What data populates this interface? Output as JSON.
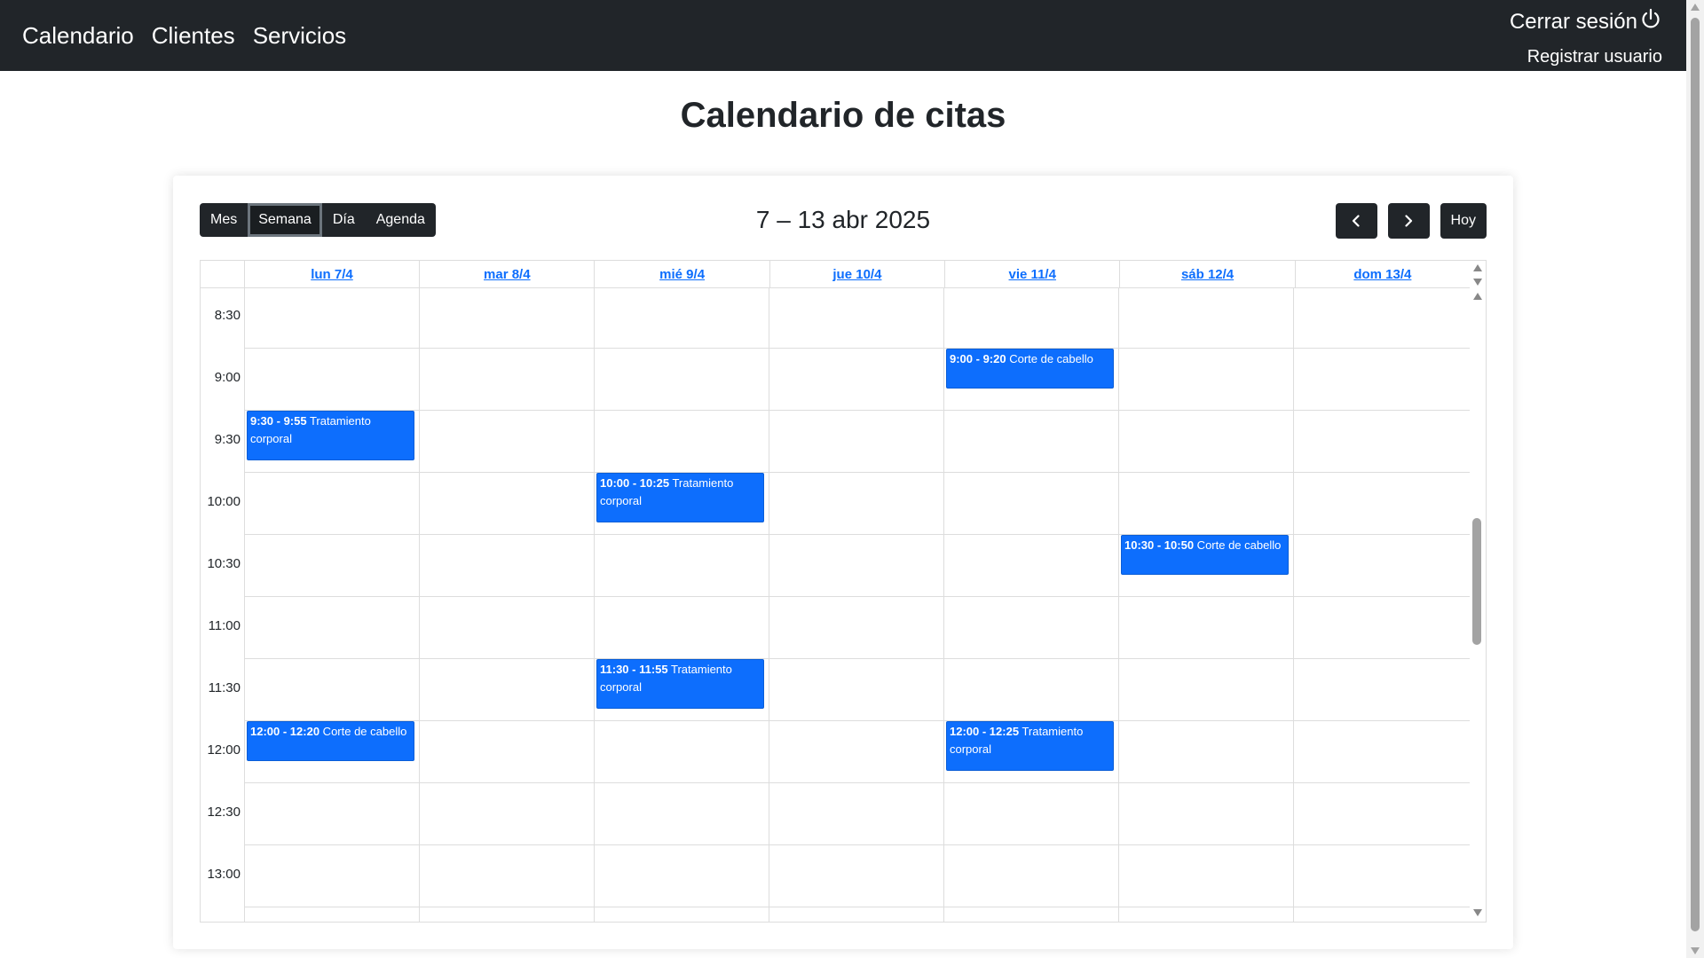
{
  "navbar": {
    "links": [
      "Calendario",
      "Clientes",
      "Servicios"
    ],
    "logout_label": "Cerrar sesión",
    "register_label": "Registrar usuario"
  },
  "page": {
    "title": "Calendario de citas"
  },
  "toolbar": {
    "views": [
      "Mes",
      "Semana",
      "Día",
      "Agenda"
    ],
    "active_view": "Semana",
    "range_label": "7 – 13 abr 2025",
    "today_label": "Hoy"
  },
  "calendar": {
    "days": [
      "lun 7/4",
      "mar 8/4",
      "mié 9/4",
      "jue 10/4",
      "vie 11/4",
      "sáb 12/4",
      "dom 13/4"
    ],
    "time_slots": [
      "8:30",
      "9:00",
      "9:30",
      "10:00",
      "10:30",
      "11:00",
      "11:30",
      "12:00",
      "12:30",
      "13:00"
    ],
    "events": [
      {
        "day": 4,
        "start": "9:00",
        "end": "9:20",
        "time_label": "9:00 - 9:20",
        "title": "Corte de cabello"
      },
      {
        "day": 0,
        "start": "9:30",
        "end": "9:55",
        "time_label": "9:30 - 9:55",
        "title": "Tratamiento corporal"
      },
      {
        "day": 2,
        "start": "10:00",
        "end": "10:25",
        "time_label": "10:00 - 10:25",
        "title": "Tratamiento corporal"
      },
      {
        "day": 5,
        "start": "10:30",
        "end": "10:50",
        "time_label": "10:30 - 10:50",
        "title": "Corte de cabello"
      },
      {
        "day": 2,
        "start": "11:30",
        "end": "11:55",
        "time_label": "11:30 - 11:55",
        "title": "Tratamiento corporal"
      },
      {
        "day": 0,
        "start": "12:00",
        "end": "12:20",
        "time_label": "12:00 - 12:20",
        "title": "Corte de cabello"
      },
      {
        "day": 4,
        "start": "12:00",
        "end": "12:25",
        "time_label": "12:00 - 12:25",
        "title": "Tratamiento corporal"
      }
    ]
  },
  "colors": {
    "navbar": "#212529",
    "event": "#0d6efd",
    "link": "#0d6efd"
  }
}
